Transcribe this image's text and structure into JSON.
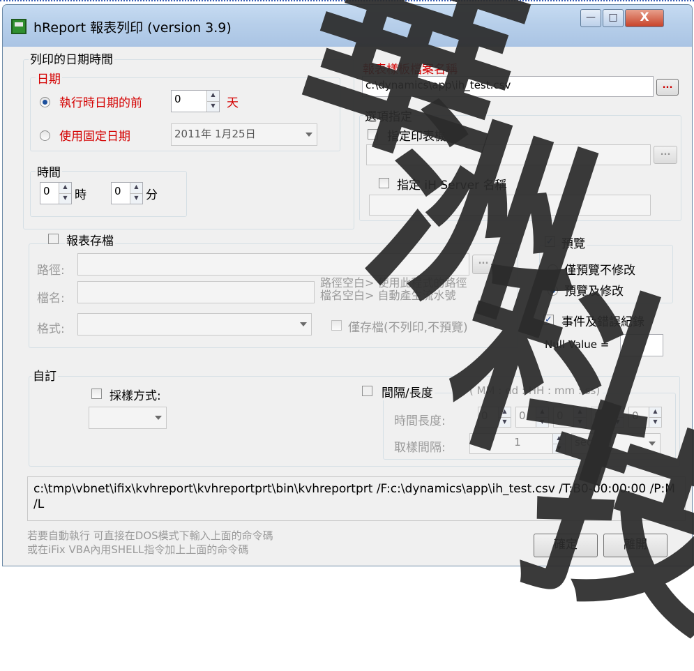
{
  "window": {
    "title": "hReport 報表列印 (version 3.9)",
    "buttons": {
      "minimize": "—",
      "maximize": "□",
      "close": "X"
    }
  },
  "print_datetime": {
    "group_label": "列印的日期時間",
    "date": {
      "label": "日期",
      "option_before": "執行時日期的前",
      "days_value": "0",
      "days_unit": "天",
      "option_fixed": "使用固定日期",
      "fixed_date_value": "2011年  1月25日",
      "selected": "before"
    },
    "time": {
      "label": "時間",
      "hour_value": "0",
      "hour_unit": "時",
      "minute_value": "0",
      "minute_unit": "分"
    }
  },
  "template": {
    "label": "報表樣板檔案名稱",
    "path_value": "c:\\dynamics\\app\\ih_test.csv",
    "browse_label": "..."
  },
  "options": {
    "group_label": "選項指定",
    "printer_label": "指定印表機",
    "printer_checked": false,
    "printer_value": "",
    "printer_browse_label": "...",
    "server_label": "指定 iH Server 名稱",
    "server_checked": false,
    "server_value": ""
  },
  "save_report": {
    "label": "報表存檔",
    "checked": false,
    "path_label": "路徑:",
    "path_value": "",
    "path_browse_label": "...",
    "filename_label": "檔名:",
    "filename_value": "",
    "format_label": "格式:",
    "format_value": "",
    "hint_line1": "路徑空白> 使用此程式的路徑",
    "hint_line2": "檔名空白> 自動產生流水號",
    "save_only_label": "僅存檔(不列印,不預覽)",
    "save_only_checked": false
  },
  "preview": {
    "label": "預覽",
    "checked": true,
    "option_no_edit": "僅預覽不修改",
    "option_edit": "預覽及修改",
    "selected": "edit"
  },
  "event_log": {
    "label": "事件及錯誤紀錄",
    "checked": true,
    "null_value_label": "Null Value =",
    "null_value": ""
  },
  "custom": {
    "group_label": "自訂",
    "sampling_label": "採樣方式:",
    "sampling_checked": false,
    "sampling_value": "",
    "interval_label": "間隔/長度",
    "interval_checked": false,
    "interval_format": "( MM :   dd   : HH :   mm :  ss)",
    "duration_label": "時間長度:",
    "duration_values": [
      "0",
      "0",
      "0",
      "0",
      "0"
    ],
    "sample_interval_label": "取樣間隔:",
    "sample_interval_value": "1",
    "sample_unit_value": "second"
  },
  "command": {
    "text": "c:\\tmp\\vbnet\\ifix\\kvhreport\\kvhreportprt\\bin\\kvhreportprt /F:c:\\dynamics\\app\\ih_test.csv /T:B0-00:00:00 /P:M /L",
    "hint_line1": "若要自動執行 可直接在DOS模式下輸入上面的命令碼",
    "hint_line2": "或在iFix VBA內用SHELL指令加上上面的命令碼"
  },
  "buttons": {
    "ok": "確定",
    "exit": "離開"
  },
  "watermark": {
    "chars": [
      "華",
      "洲",
      "科",
      "技"
    ]
  },
  "colors": {
    "accent_red": "#d40000",
    "title_bar": "#b7cfea",
    "watermark": "#2c2c2c"
  }
}
